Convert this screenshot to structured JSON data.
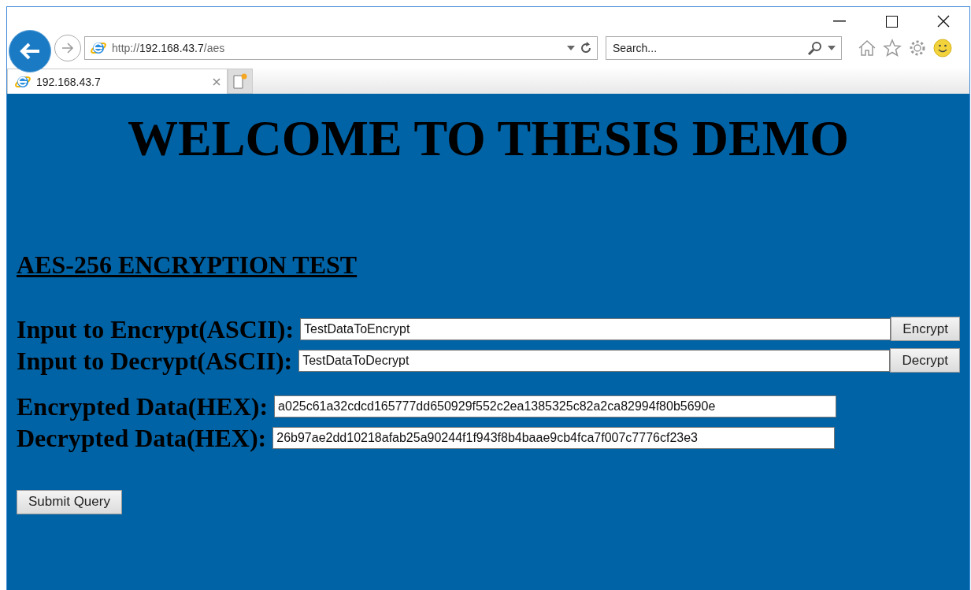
{
  "browser": {
    "address": {
      "scheme": "http://",
      "host": "192.168.43.7",
      "path": "/aes"
    },
    "search": {
      "placeholder": "Search..."
    },
    "tabs": [
      {
        "label": "192.168.43.7",
        "selected": true
      }
    ]
  },
  "page": {
    "title": "WELCOME TO THESIS DEMO",
    "section": "AES-256 ENCRYPTION TEST",
    "groups": [
      [
        {
          "kind": "action",
          "label": "Input to Encrypt(ASCII):",
          "value": "TestDataToEncrypt",
          "button": "Encrypt"
        },
        {
          "kind": "action",
          "label": "Input to Decrypt(ASCII):",
          "value": "TestDataToDecrypt",
          "button": "Decrypt"
        }
      ],
      [
        {
          "kind": "output",
          "label": "Encrypted Data(HEX):",
          "value": "a025c61a32cdcd165777dd650929f552c2ea1385325c82a2ca82994f80b5690e"
        },
        {
          "kind": "output",
          "label": "Decrypted Data(HEX):",
          "value": "26b97ae2dd10218afab25a90244f1f943f8b4baae9cb4fca7f007c7776cf23e3"
        }
      ]
    ],
    "submit": "Submit Query"
  }
}
